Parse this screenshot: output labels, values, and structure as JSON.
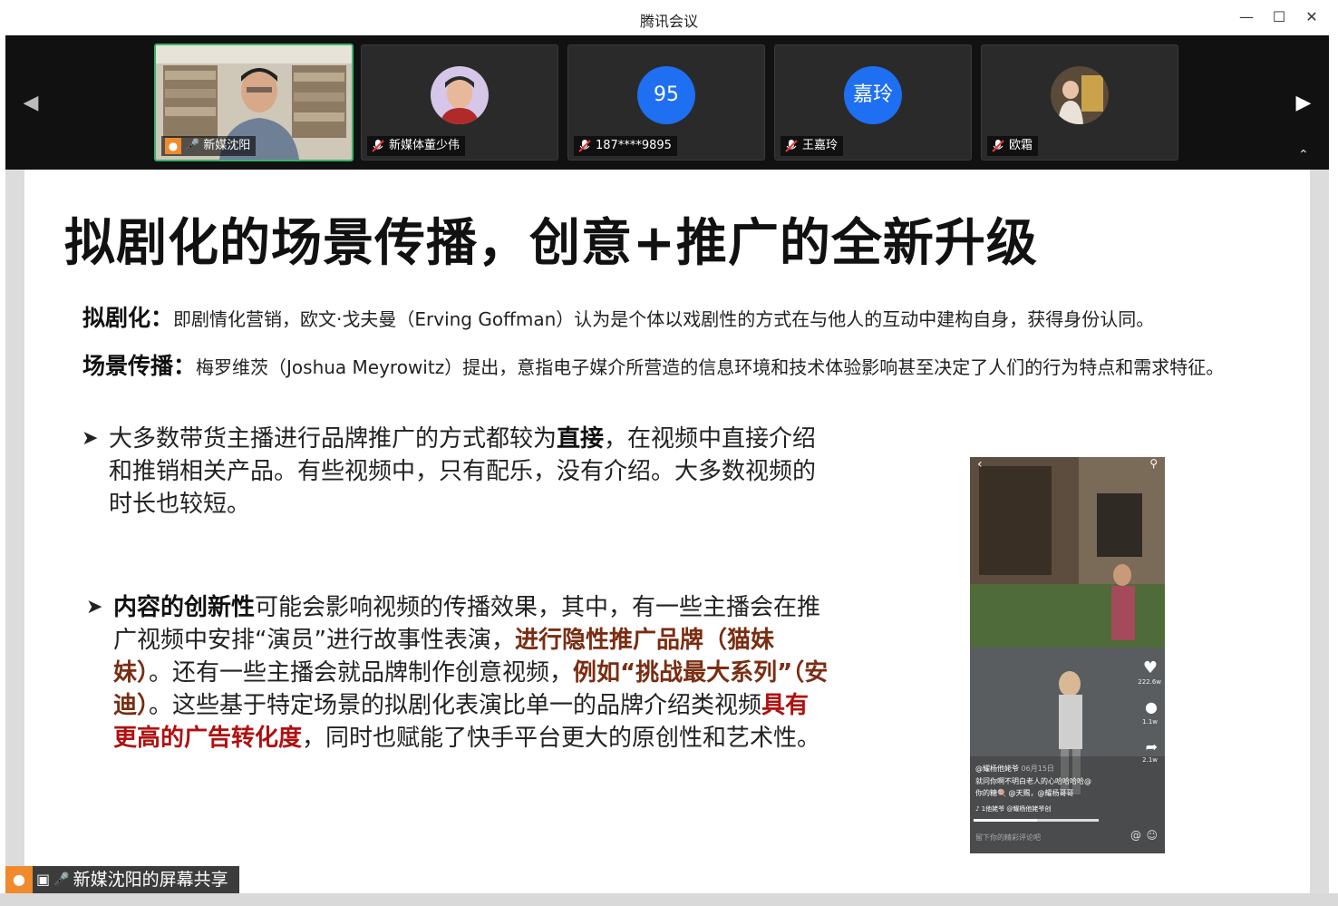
{
  "window": {
    "title": "腾讯会议"
  },
  "participants": [
    {
      "name": "新媒沈阳",
      "type": "video",
      "active": true
    },
    {
      "name": "新媒体董少伟",
      "type": "photo"
    },
    {
      "name": "187****9895",
      "type": "initials",
      "initials": "95"
    },
    {
      "name": "王嘉玲",
      "type": "initials",
      "initials": "嘉玲"
    },
    {
      "name": "欧霜",
      "type": "photo"
    }
  ],
  "slide": {
    "title": "拟剧化的场景传播，创意+推广的全新升级",
    "defs": [
      {
        "term": "拟剧化：",
        "text": "即剧情化营销，欧文·戈夫曼（Erving Goffman）认为是个体以戏剧性的方式在与他人的互动中建构自身，获得身份认同。"
      },
      {
        "term": "场景传播：",
        "text": "梅罗维茨（Joshua Meyrowitz）提出，意指电子媒介所营造的信息环境和技术体验影响甚至决定了人们的行为特点和需求特征。"
      }
    ],
    "bullet1": {
      "part1": "大多数带货主播进行品牌推广的方式都较为",
      "bold1": "直接",
      "part2": "，在视频中直接介绍和推销相关产品。有些视频中，只有配乐，没有介绍。大多数视频的时长也较短。"
    },
    "bullet2": {
      "bold1": "内容的创新性",
      "part1": "可能会影响视频的传播效果，其中，有一些主播会在推广视频中安排“演员”进行故事性表演，",
      "bold2": "进行隐性推广品牌（猫妹妹）",
      "part2": "。还有一些主播会就品牌制作创意视频，",
      "bold3": "例如“挑战最大系列”（安迪）",
      "part3": "。这些基于特定场景的拟剧化表演比单一的品牌介绍类视频",
      "bold4": "具有更高的广告转化度",
      "part4": "，同时也赋能了快手平台更大的原创性和艺术性。"
    },
    "phone": {
      "likes": "222.6w",
      "comments": "1.1w",
      "shares": "2.1w",
      "author": "@耀杨他姥爷",
      "date": "06月15日",
      "caption": "就问你啊不明白老人的心哈哈哈哈@",
      "caption2": "你的糖🍭 @天赐，@耀杨哥哥",
      "music": "♪ 1他姥爷  @耀杨他姥爷创",
      "comment_placeholder": "留下你的精彩评论吧"
    }
  },
  "share_label": "新媒沈阳的屏幕共享"
}
